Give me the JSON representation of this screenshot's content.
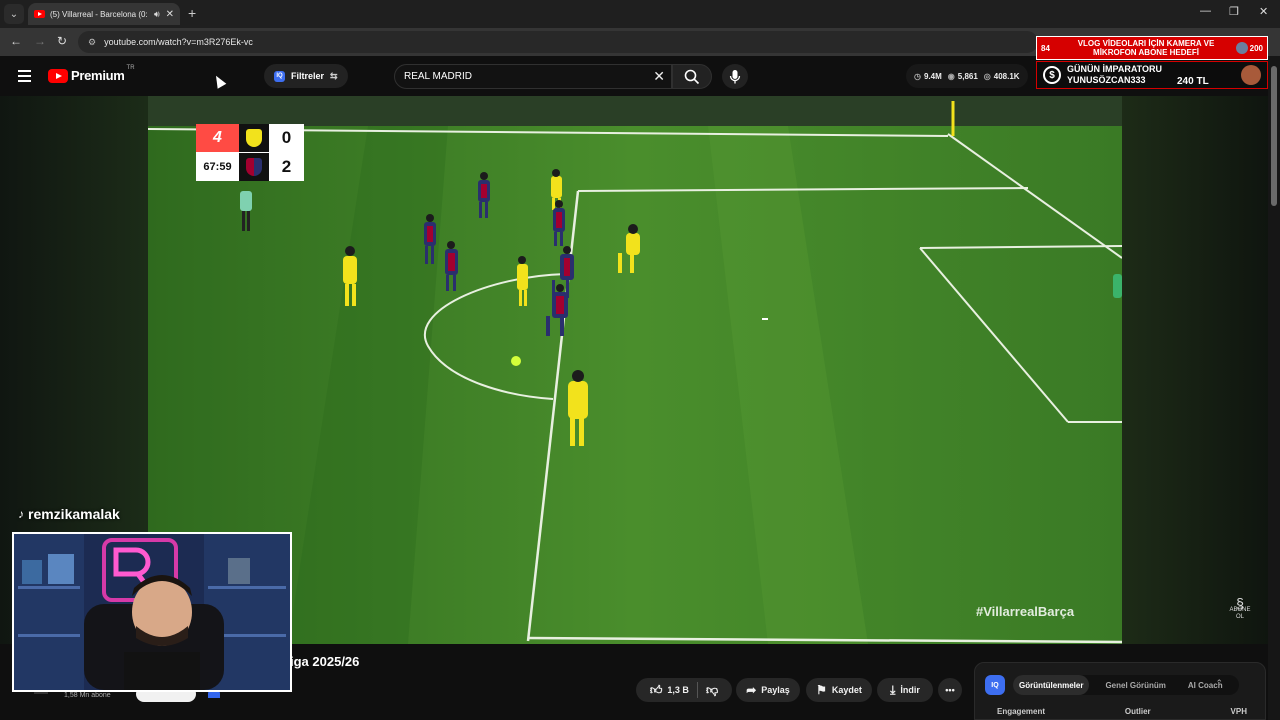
{
  "browser": {
    "tab_title": "(5) Villarreal - Barcelona (0:",
    "url": "youtube.com/watch?v=m3R276Ek-vc"
  },
  "overlay": {
    "goal_left": "84",
    "goal_text_line1": "VLOG VİDEOLARI İÇİN KAMERA VE",
    "goal_text_line2": "MİKROFON ABONE HEDEFİ",
    "goal_right": "200",
    "emperor_title": "GÜNÜN İMPARATORU",
    "emperor_name": "YUNUSÖZCAN333",
    "emperor_amount": "240 TL",
    "streamer_name": "remzikamalak"
  },
  "youtube": {
    "logo_text": "Premium",
    "logo_sup": "TR",
    "filters_label": "Filtreler",
    "search_value": "REAL MADRID",
    "stats": {
      "views": "9.4M",
      "eye": "5,861",
      "likes": "408.1K"
    }
  },
  "video": {
    "scoreboard": {
      "league_mark": "4",
      "clock": "67:59",
      "home_score": "0",
      "away_score": "2"
    },
    "hashtag": "#VillarrealBarça",
    "watermark": "ABONE OL",
    "title_fragment": "iga 2025/26",
    "subs": "1,58 Mn abone"
  },
  "actions": {
    "like_count": "1,3 B",
    "share": "Paylaş",
    "save": "Kaydet",
    "download": "İndir"
  },
  "panel": {
    "logo": "IQ",
    "tab1": "Görüntülenmeler",
    "tab2": "Genel Görünüm",
    "tab3": "AI Coach",
    "col1": "Engagement",
    "col2": "Outlier",
    "col3": "VPH"
  },
  "colors": {
    "pitch": "#3b7a24",
    "youtube_red": "#ff0000",
    "overlay_red": "#d60000",
    "villarreal_yellow": "#f2e21c",
    "barca_blue": "#2a2f6e"
  }
}
